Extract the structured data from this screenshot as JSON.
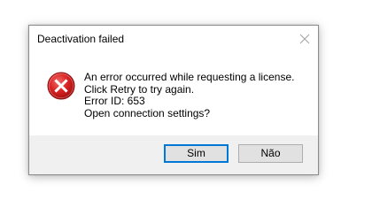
{
  "dialog": {
    "title": "Deactivation failed",
    "icon": "error-icon",
    "message_lines": [
      "An error occurred while requesting a license.",
      "Click Retry to try again.",
      "Error ID: 653",
      "Open connection settings?"
    ],
    "buttons": {
      "yes_label": "Sim",
      "no_label": "Não"
    }
  },
  "colors": {
    "error_red": "#e81123",
    "focus_border": "#0078d7",
    "footer_bg": "#f0f0f0"
  }
}
